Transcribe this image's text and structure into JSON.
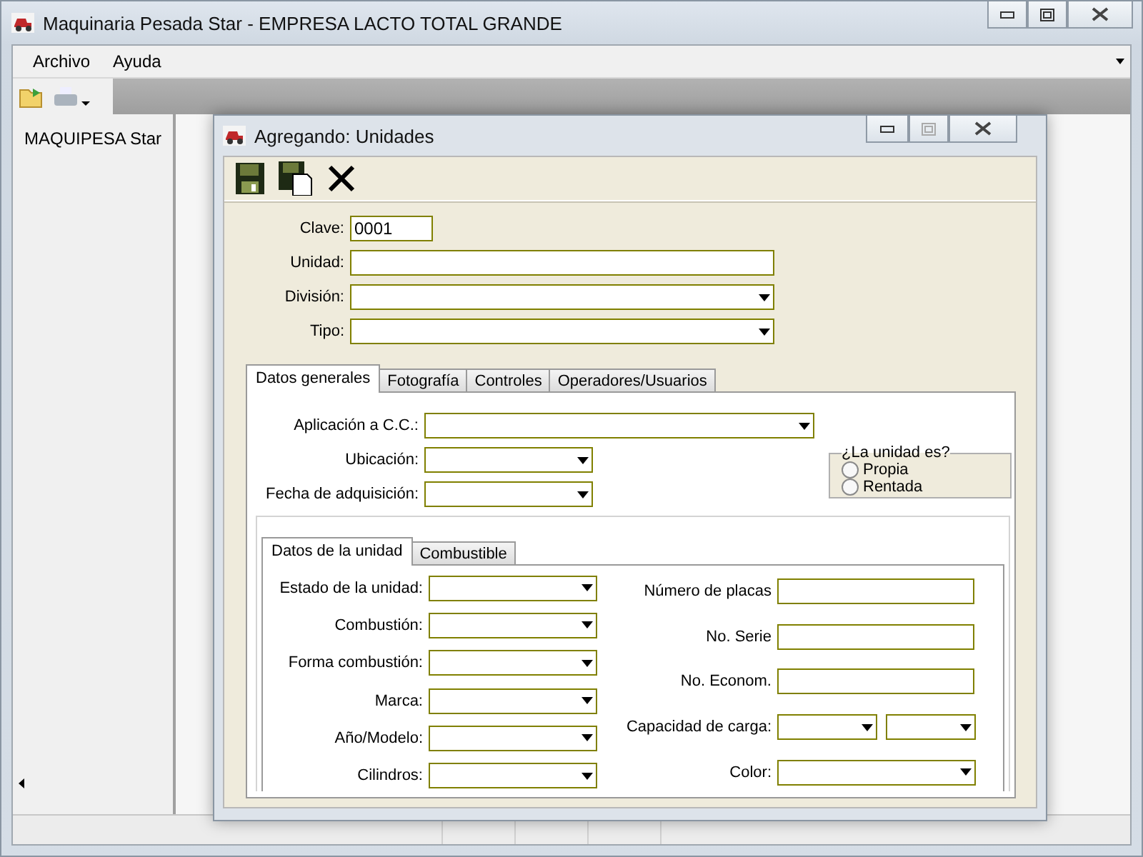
{
  "window": {
    "title": "Maquinaria Pesada Star - EMPRESA LACTO TOTAL GRANDE"
  },
  "menu": [
    "Archivo",
    "Ayuda"
  ],
  "sidebar": {
    "title": "MAQUIPESA Star"
  },
  "child_window": {
    "title": "Agregando: Unidades",
    "fields": [
      {
        "label": "Clave:",
        "kind": "text",
        "value": "0001"
      },
      {
        "label": "Unidad:",
        "kind": "text"
      },
      {
        "label": "División:",
        "kind": "dropdown"
      },
      {
        "label": "Tipo:",
        "kind": "dropdown"
      }
    ],
    "tabs": [
      {
        "label": "Datos generales",
        "selected": true
      },
      {
        "label": "Fotografía",
        "selected": false
      },
      {
        "label": "Controles",
        "selected": false
      },
      {
        "label": "Operadores/Usuarios",
        "selected": false
      }
    ],
    "general": {
      "fields": [
        {
          "label": "Aplicación a C.C.:",
          "kind": "dropdown"
        },
        {
          "label": "Ubicación:",
          "kind": "dropdown"
        },
        {
          "label": "Fecha de adquisición:",
          "kind": "dropdown"
        }
      ],
      "ownership": {
        "legend": "¿La unidad es?",
        "options": [
          {
            "label": "Propia",
            "selected": false
          },
          {
            "label": "Rentada",
            "selected": false
          }
        ]
      }
    },
    "inner_tabs": [
      {
        "label": "Datos de la unidad",
        "selected": true
      },
      {
        "label": "Combustible",
        "selected": false
      }
    ],
    "unit_left": [
      {
        "label": "Estado de la unidad:",
        "kind": "dropdown"
      },
      {
        "label": "Combustión:",
        "kind": "dropdown"
      },
      {
        "label": "Forma combustión:",
        "kind": "dropdown"
      },
      {
        "label": "Marca:",
        "kind": "dropdown"
      },
      {
        "label": "Año/Modelo:",
        "kind": "dropdown"
      },
      {
        "label": "Cilindros:",
        "kind": "dropdown"
      }
    ],
    "unit_right": [
      {
        "label": "Número de placas",
        "kind": "text"
      },
      {
        "label": "No. Serie",
        "kind": "text"
      },
      {
        "label": "No. Econom.",
        "kind": "text"
      },
      {
        "label": "Capacidad de carga:",
        "kind": "dual_dropdown"
      },
      {
        "label": "Color:",
        "kind": "dropdown"
      }
    ]
  }
}
